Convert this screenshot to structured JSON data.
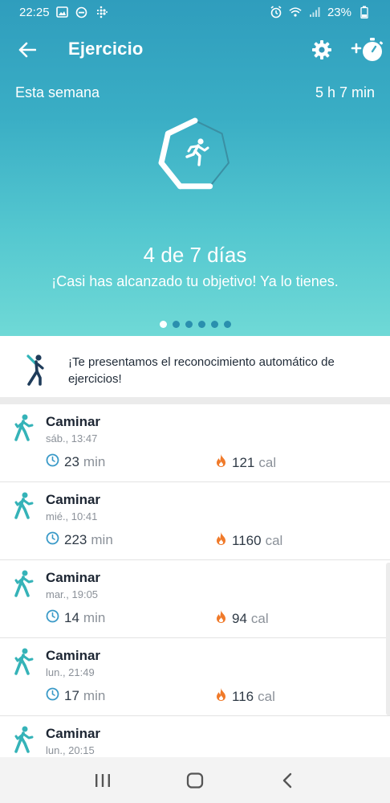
{
  "status_bar": {
    "time": "22:25",
    "battery": "23%",
    "icons": [
      "image-icon",
      "dnd-icon",
      "fitbit-icon",
      "alarm-icon",
      "wifi-icon",
      "signal-icon",
      "battery-icon"
    ]
  },
  "app_bar": {
    "title": "Ejercicio",
    "icons": [
      "back-arrow-icon",
      "gear-icon",
      "add-exercise-timer-icon"
    ]
  },
  "summary": {
    "week_label": "Esta semana",
    "week_total": "5 h 7 min",
    "days_text": "4 de 7 días",
    "message": "¡Casi has alcanzado tu objetivo! Ya lo tienes.",
    "days_done": 4,
    "days_goal": 7,
    "page_count": 6,
    "active_page": 0
  },
  "promo": {
    "text": "¡Te presentamos el reconocimiento automático de ejercicios!",
    "icon": "stretching-person-icon"
  },
  "activities": [
    {
      "name": "Caminar",
      "time": "sáb., 13:47",
      "duration": "23",
      "duration_unit": "min",
      "calories": "121",
      "calories_unit": "cal"
    },
    {
      "name": "Caminar",
      "time": "mié., 10:41",
      "duration": "223",
      "duration_unit": "min",
      "calories": "1160",
      "calories_unit": "cal"
    },
    {
      "name": "Caminar",
      "time": "mar., 19:05",
      "duration": "14",
      "duration_unit": "min",
      "calories": "94",
      "calories_unit": "cal"
    },
    {
      "name": "Caminar",
      "time": "lun., 21:49",
      "duration": "17",
      "duration_unit": "min",
      "calories": "116",
      "calories_unit": "cal"
    },
    {
      "name": "Caminar",
      "time": "lun., 20:15"
    }
  ],
  "colors": {
    "accent_teal": "#3fb8c4",
    "flame": "#f07a2a",
    "clock": "#3a9ac8"
  },
  "nav": {
    "icons": [
      "recent-apps-icon",
      "home-icon",
      "back-icon"
    ]
  }
}
